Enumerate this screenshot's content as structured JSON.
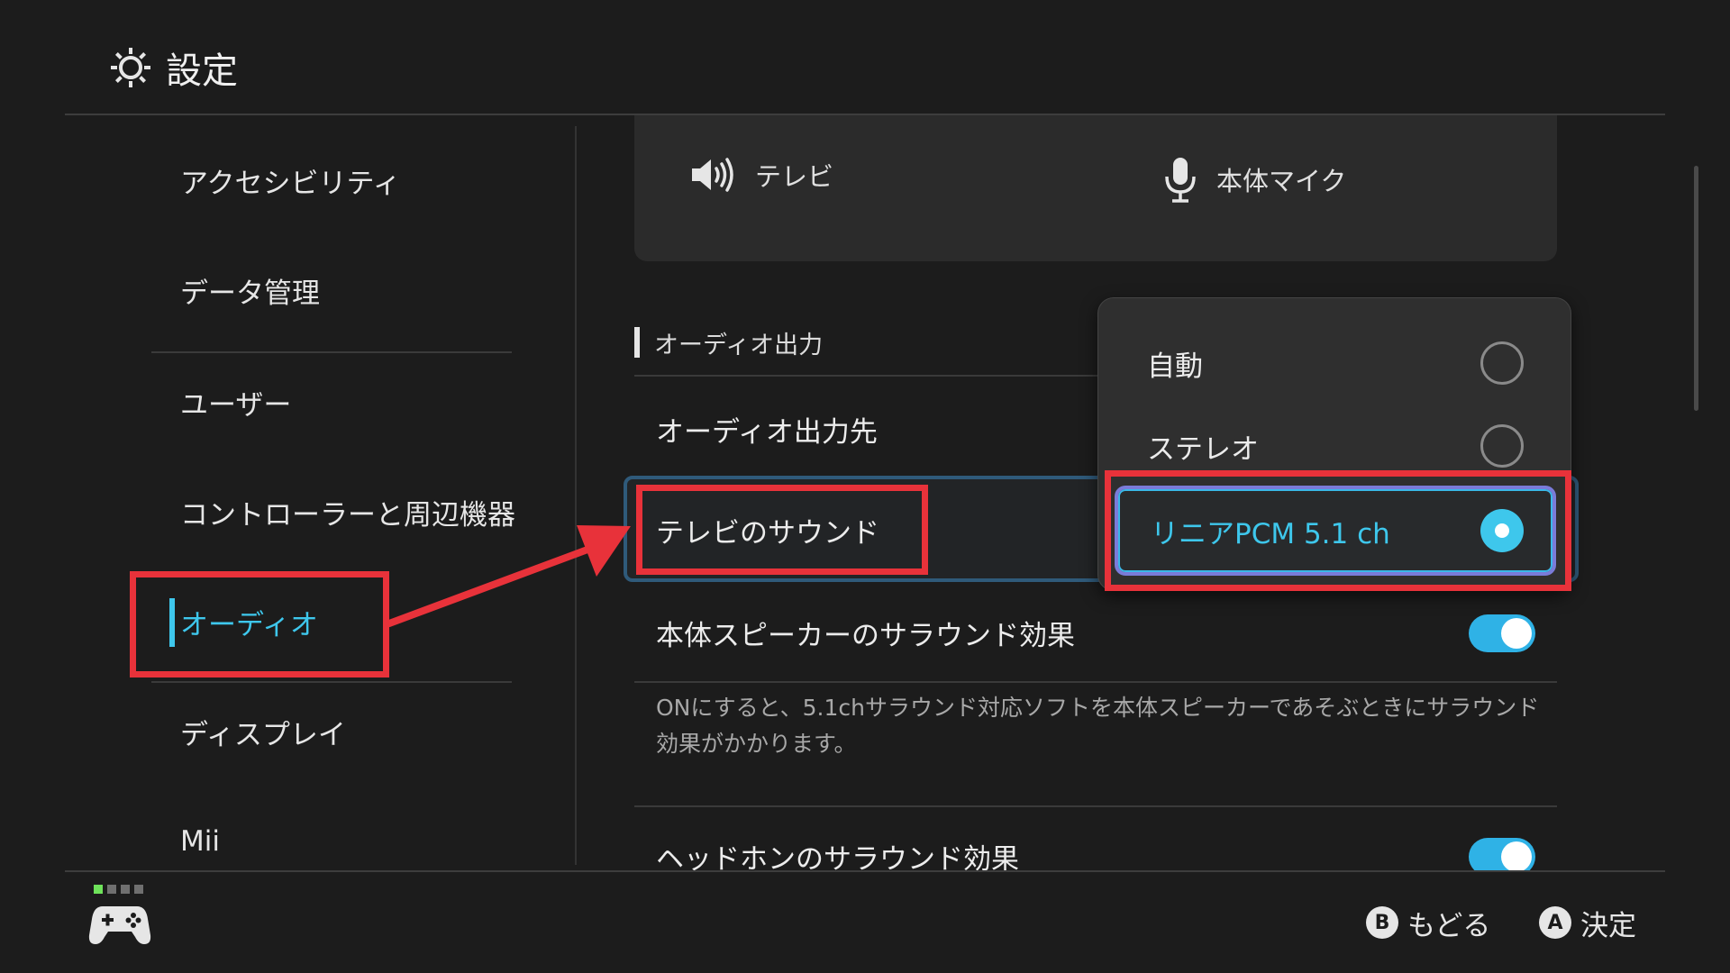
{
  "header": {
    "title": "設定",
    "icon": "gear-icon"
  },
  "sidebar": {
    "items": [
      {
        "label": "アクセシビリティ"
      },
      {
        "label": "データ管理"
      },
      {
        "label": "ユーザー"
      },
      {
        "label": "コントローラーと周辺機器"
      },
      {
        "label": "オーディオ",
        "selected": true
      },
      {
        "label": "ディスプレイ"
      },
      {
        "label": "Mii"
      }
    ]
  },
  "content": {
    "io": {
      "output_label": "テレビ",
      "output_icon": "speaker-icon",
      "input_label": "本体マイク",
      "input_icon": "microphone-icon"
    },
    "section_title": "オーディオ出力",
    "rows": {
      "output_dest": "オーディオ出力先",
      "tv_sound": "テレビのサウンド",
      "speaker_surround": "本体スピーカーのサラウンド効果",
      "speaker_surround_desc": "ONにすると、5.1chサラウンド対応ソフトを本体スピーカーであそぶときにサラウンド効果がかかります。",
      "headphone_surround": "ヘッドホンのサラウンド効果"
    },
    "toggles": {
      "speaker_surround_on": true,
      "headphone_surround_on": true
    }
  },
  "dropdown": {
    "options": [
      {
        "label": "自動",
        "selected": false
      },
      {
        "label": "ステレオ",
        "selected": false
      },
      {
        "label": "リニアPCM 5.1 ch",
        "selected": true
      }
    ]
  },
  "footer": {
    "back": {
      "glyph": "B",
      "label": "もどる"
    },
    "confirm": {
      "glyph": "A",
      "label": "決定"
    }
  },
  "colors": {
    "accent": "#3ec7ec",
    "annotation": "#e8323a",
    "background": "#1c1c1c"
  }
}
